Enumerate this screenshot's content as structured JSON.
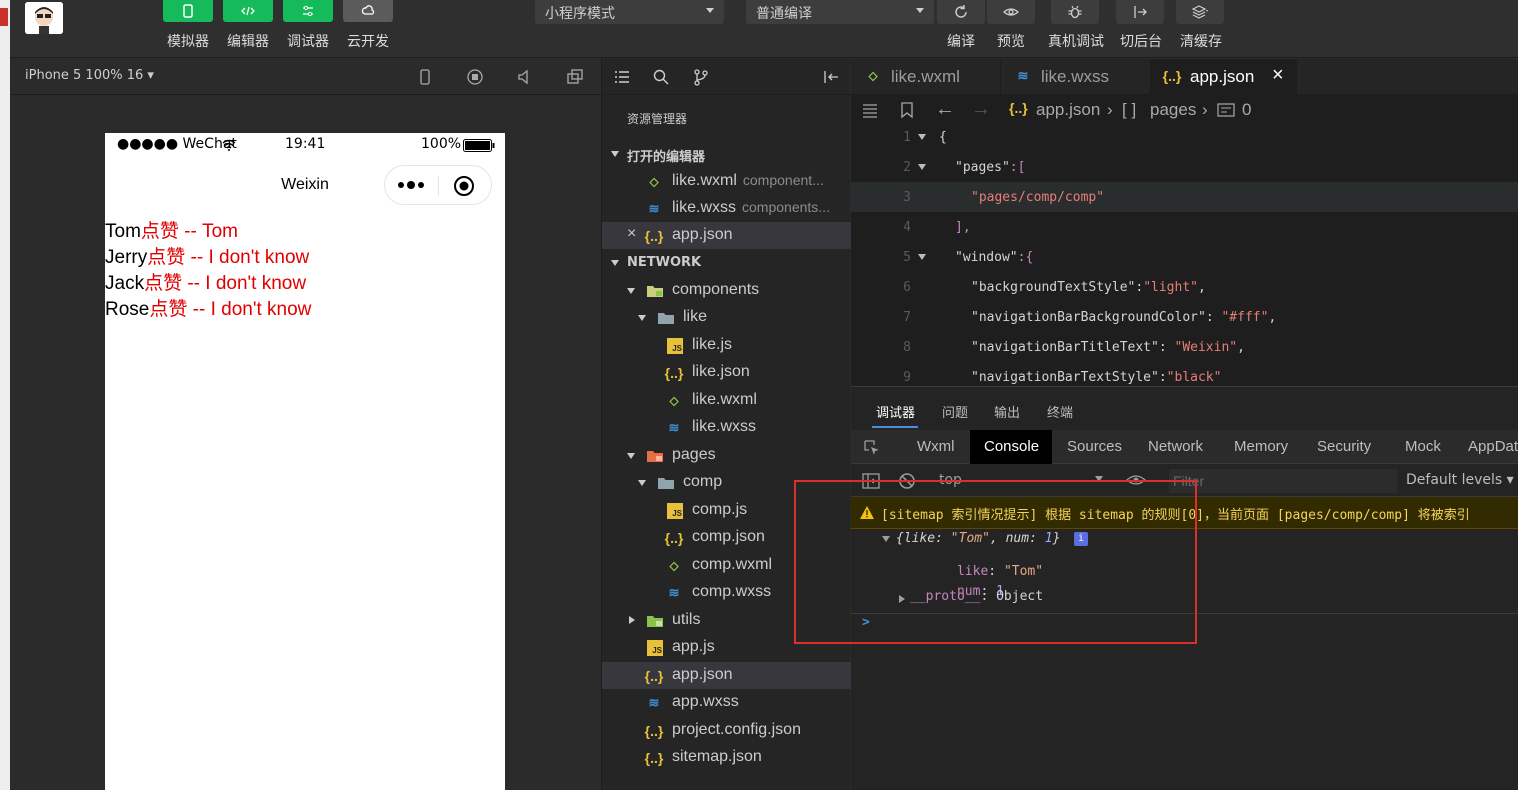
{
  "toolbar": {
    "left_buttons": [
      {
        "label": "模拟器",
        "color": "#15ba5b"
      },
      {
        "label": "编辑器",
        "color": "#15ba5b"
      },
      {
        "label": "调试器",
        "color": "#15ba5b"
      },
      {
        "label": "云开发",
        "color": "#5b5b5b"
      }
    ],
    "mode_select": "小程序模式",
    "compile_select": "普通编译",
    "right_buttons": [
      "编译",
      "预览",
      "真机调试",
      "切后台",
      "清缓存"
    ]
  },
  "simulator": {
    "device_label": "iPhone 5 100% 16",
    "status": {
      "carrier": "●●●●● WeChat",
      "time": "19:41",
      "battery": "100%"
    },
    "nav_title": "Weixin",
    "lines": [
      {
        "name": "Tom",
        "rest": "点赞 -- Tom"
      },
      {
        "name": "Jerry",
        "rest": "点赞 -- I don't know"
      },
      {
        "name": "Jack",
        "rest": "点赞 -- I don't know"
      },
      {
        "name": "Rose",
        "rest": "点赞 -- I don't know"
      }
    ]
  },
  "explorer": {
    "title": "资源管理器",
    "open_editors_header": "打开的编辑器",
    "open_editors": [
      {
        "name": "like.wxml",
        "path": "component..."
      },
      {
        "name": "like.wxss",
        "path": "components..."
      },
      {
        "name": "app.json",
        "path": ""
      }
    ],
    "project_header": "NETWORK",
    "tree": [
      {
        "name": "components"
      },
      {
        "name": "like"
      },
      {
        "name": "like.js"
      },
      {
        "name": "like.json"
      },
      {
        "name": "like.wxml"
      },
      {
        "name": "like.wxss"
      },
      {
        "name": "pages"
      },
      {
        "name": "comp"
      },
      {
        "name": "comp.js"
      },
      {
        "name": "comp.json"
      },
      {
        "name": "comp.wxml"
      },
      {
        "name": "comp.wxss"
      },
      {
        "name": "utils"
      },
      {
        "name": "app.js"
      },
      {
        "name": "app.json"
      },
      {
        "name": "app.wxss"
      },
      {
        "name": "project.config.json"
      },
      {
        "name": "sitemap.json"
      }
    ]
  },
  "editor": {
    "tabs": [
      "like.wxml",
      "like.wxss",
      "app.json"
    ],
    "breadcrumb": {
      "file": "app.json",
      "node1": "pages",
      "node2": "0"
    },
    "lines": [
      {
        "n": "1",
        "text": "{"
      },
      {
        "n": "2",
        "key": "\"pages\"",
        "rest": ":["
      },
      {
        "n": "3",
        "str": "\"pages/comp/comp\""
      },
      {
        "n": "4",
        "text": "],"
      },
      {
        "n": "5",
        "key": "\"window\"",
        "rest": ":{"
      },
      {
        "n": "6",
        "key": "\"backgroundTextStyle\"",
        "sep": ":",
        "str": "\"light\"",
        "tail": ","
      },
      {
        "n": "7",
        "key": "\"navigationBarBackgroundColor\"",
        "sep": ": ",
        "str": "\"#fff\"",
        "tail": ","
      },
      {
        "n": "8",
        "key": "\"navigationBarTitleText\"",
        "sep": ": ",
        "str": "\"Weixin\"",
        "tail": ","
      },
      {
        "n": "9",
        "key": "\"navigationBarTextStyle\"",
        "sep": ":",
        "str": "\"black\"",
        "tail": ""
      }
    ]
  },
  "devtools": {
    "top_tabs": [
      "调试器",
      "问题",
      "输出",
      "终端"
    ],
    "panel_tabs": [
      "Wxml",
      "Console",
      "Sources",
      "Network",
      "Memory",
      "Security",
      "Mock",
      "AppData"
    ],
    "context": "top",
    "filter_placeholder": "Filter",
    "levels": "Default levels",
    "warning": "[sitemap 索引情况提示] 根据 sitemap 的规则[0]，当前页面 [pages/comp/comp] 将被索引",
    "object_summary": {
      "open": "{",
      "k1": "like",
      "v1": "\"Tom\"",
      "k2": "num",
      "v2": "1",
      "close": "}"
    },
    "props": [
      {
        "key": "like",
        "value": "\"Tom\""
      },
      {
        "key": "num",
        "value": "1"
      }
    ],
    "proto": {
      "key": "__proto__",
      "value": "Object"
    },
    "prompt": ">"
  }
}
